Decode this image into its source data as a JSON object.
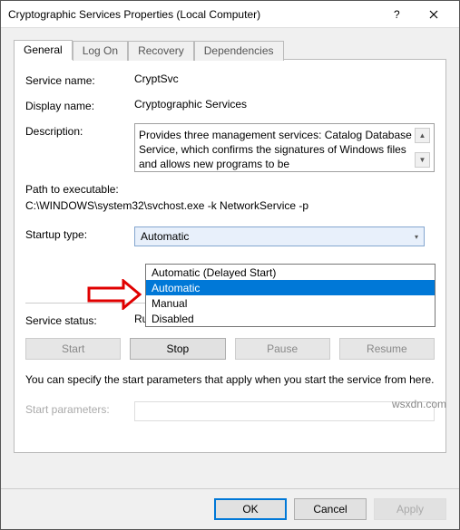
{
  "window": {
    "title": "Cryptographic Services Properties (Local Computer)"
  },
  "tabs": {
    "t0": "General",
    "t1": "Log On",
    "t2": "Recovery",
    "t3": "Dependencies"
  },
  "rows": {
    "service_name_label": "Service name:",
    "service_name_value": "CryptSvc",
    "display_name_label": "Display name:",
    "display_name_value": "Cryptographic Services",
    "description_label": "Description:",
    "description_value": "Provides three management services: Catalog Database Service, which confirms the signatures of Windows files and allows new programs to be",
    "path_label": "Path to executable:",
    "path_value": "C:\\WINDOWS\\system32\\svchost.exe -k NetworkService -p",
    "startup_type_label": "Startup type:",
    "startup_type_value": "Automatic",
    "service_status_label": "Service status:",
    "service_status_value": "Running",
    "start_params_label": "Start parameters:"
  },
  "dropdown": {
    "o0": "Automatic (Delayed Start)",
    "o1": "Automatic",
    "o2": "Manual",
    "o3": "Disabled"
  },
  "buttons": {
    "start": "Start",
    "stop": "Stop",
    "pause": "Pause",
    "resume": "Resume"
  },
  "note": "You can specify the start parameters that apply when you start the service from here.",
  "footer": {
    "ok": "OK",
    "cancel": "Cancel",
    "apply": "Apply"
  },
  "watermark": "wsxdn.com"
}
